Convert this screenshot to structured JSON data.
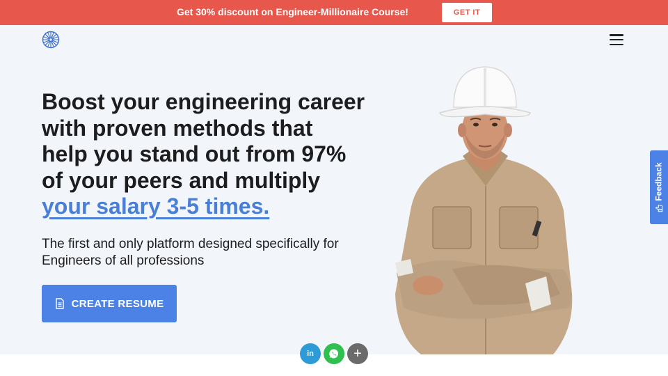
{
  "promo": {
    "text": "Get 30% discount on Engineer-Millionaire Course!",
    "button_label": "GET IT"
  },
  "header": {
    "logo_icon": "sunburst-logo-icon",
    "menu_icon": "hamburger-menu-icon"
  },
  "hero": {
    "headline_line1": "Boost your engineering career",
    "headline_line2": "with proven methods that",
    "headline_line3": "help you stand out from 97%",
    "headline_line4": "of your peers and multiply",
    "headline_accent": "your salary 3-5 times.",
    "subheadline": "The first and only platform designed specifically for Engineers of all professions",
    "cta_label": "CREATE RESUME",
    "cta_icon": "document-icon"
  },
  "feedback": {
    "label": "Feedback"
  },
  "share": {
    "linkedin_label": "in",
    "more_label": "+"
  },
  "colors": {
    "promo_bg": "#e8574b",
    "accent": "#4c82e6",
    "hero_bg": "#f2f5f9"
  }
}
